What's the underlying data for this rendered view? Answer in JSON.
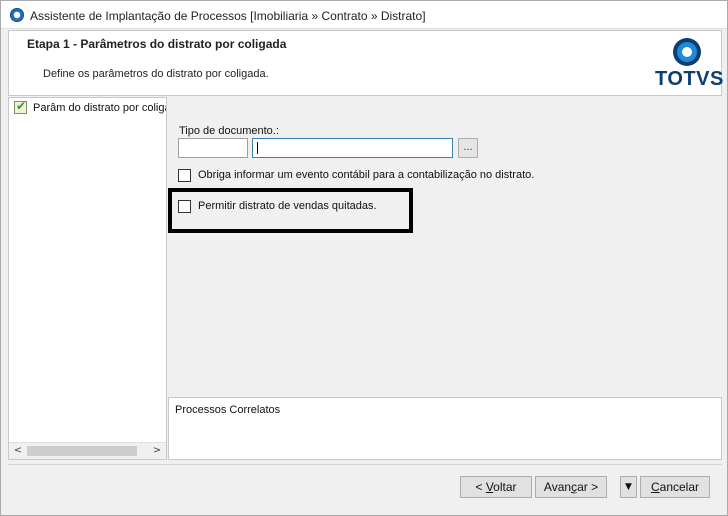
{
  "window": {
    "title": "Assistente de Implantação de Processos [Imobiliaria » Contrato » Distrato]"
  },
  "header": {
    "step_title": "Etapa 1 - Parâmetros do distrato por coligada",
    "description": "Define os parâmetros do distrato por coligada.",
    "logo_text": "TOTVS"
  },
  "tree": {
    "items": [
      {
        "label": "Parâm do distrato por coligada",
        "completed": true
      }
    ]
  },
  "form": {
    "doc_type_label": "Tipo de documento.:",
    "doc_code_value": "",
    "doc_name_value": "",
    "browse_button_label": "...",
    "checkbox_evento": {
      "label": "Obriga informar um evento contábil para a contabilização no distrato.",
      "checked": false
    },
    "checkbox_vendas": {
      "label": "Permitir distrato de vendas quitadas.",
      "checked": false
    }
  },
  "related": {
    "label": "Processos Correlatos"
  },
  "buttons": {
    "back_prefix": "< ",
    "back_accel": "V",
    "back_rest": "oltar",
    "next_prefix": "Avan",
    "next_accel": "ç",
    "next_rest": "ar >",
    "dropdown_glyph": "▼",
    "cancel_accel": "C",
    "cancel_rest": "ancelar"
  },
  "icons": {
    "app": "totvs-app-icon",
    "tree_item": "checklist-icon",
    "scroll_left": "chevron-left-icon",
    "scroll_right": "chevron-right-icon"
  }
}
